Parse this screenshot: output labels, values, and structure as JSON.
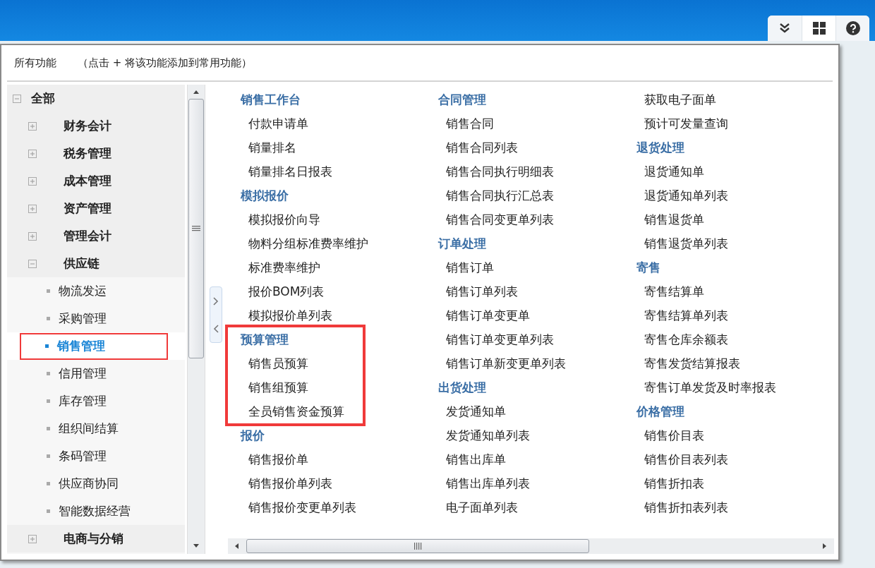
{
  "toolbar": [
    {
      "kind": "expand",
      "selected": false
    },
    {
      "kind": "grid",
      "selected": true
    },
    {
      "kind": "help",
      "selected": false
    }
  ],
  "header": {
    "title": "所有功能",
    "hint": "（点击 + 将该功能添加到常用功能）"
  },
  "tree": [
    {
      "label": "全部",
      "expanded": true,
      "children": [
        {
          "label": "财务会计",
          "expanded": false
        },
        {
          "label": "税务管理",
          "expanded": false
        },
        {
          "label": "成本管理",
          "expanded": false
        },
        {
          "label": "资产管理",
          "expanded": false
        },
        {
          "label": "管理会计",
          "expanded": false
        },
        {
          "label": "供应链",
          "expanded": true,
          "children": [
            {
              "label": "物流发运",
              "selected": false
            },
            {
              "label": "采购管理",
              "selected": false
            },
            {
              "label": "销售管理",
              "selected": true
            },
            {
              "label": "信用管理",
              "selected": false
            },
            {
              "label": "库存管理",
              "selected": false
            },
            {
              "label": "组织间结算",
              "selected": false
            },
            {
              "label": "条码管理",
              "selected": false
            },
            {
              "label": "供应商协同",
              "selected": false
            },
            {
              "label": "智能数据经营",
              "selected": false
            }
          ]
        },
        {
          "label": "电商与分销",
          "expanded": false
        }
      ]
    }
  ],
  "columns": [
    {
      "groups": [
        {
          "title": "销售工作台",
          "highlighted": false,
          "items": [
            "付款申请单",
            "销量排名",
            "销量排名日报表"
          ]
        },
        {
          "title": "模拟报价",
          "highlighted": false,
          "items": [
            "模拟报价向导",
            "物料分组标准费率维护",
            "标准费率维护",
            "报价BOM列表",
            "模拟报价单列表"
          ]
        },
        {
          "title": "预算管理",
          "highlighted": true,
          "items": [
            "销售员预算",
            "销售组预算",
            "全员销售资金预算"
          ]
        },
        {
          "title": "报价",
          "highlighted": false,
          "items": [
            "销售报价单",
            "销售报价单列表",
            "销售报价变更单列表"
          ]
        }
      ]
    },
    {
      "groups": [
        {
          "title": "合同管理",
          "highlighted": false,
          "items": [
            "销售合同",
            "销售合同列表",
            "销售合同执行明细表",
            "销售合同执行汇总表",
            "销售合同变更单列表"
          ]
        },
        {
          "title": "订单处理",
          "highlighted": false,
          "items": [
            "销售订单",
            "销售订单列表",
            "销售订单变更单",
            "销售订单变更单列表",
            "销售订单新变更单列表"
          ]
        },
        {
          "title": "出货处理",
          "highlighted": false,
          "items": [
            "发货通知单",
            "发货通知单列表",
            "销售出库单",
            "销售出库单列表",
            "电子面单列表"
          ]
        }
      ]
    },
    {
      "groups": [
        {
          "highlighted": false,
          "items": [
            "获取电子面单",
            "预计可发量查询"
          ]
        },
        {
          "title": "退货处理",
          "highlighted": false,
          "items": [
            "退货通知单",
            "退货通知单列表",
            "销售退货单",
            "销售退货单列表"
          ]
        },
        {
          "title": "寄售",
          "highlighted": false,
          "items": [
            "寄售结算单",
            "寄售结算单列表",
            "寄售仓库余额表",
            "寄售发货结算报表",
            "寄售订单发货及时率报表"
          ]
        },
        {
          "title": "价格管理",
          "highlighted": false,
          "items": [
            "销售价目表",
            "销售价目表列表",
            "销售折扣表",
            "销售折扣表列表"
          ]
        }
      ]
    }
  ]
}
